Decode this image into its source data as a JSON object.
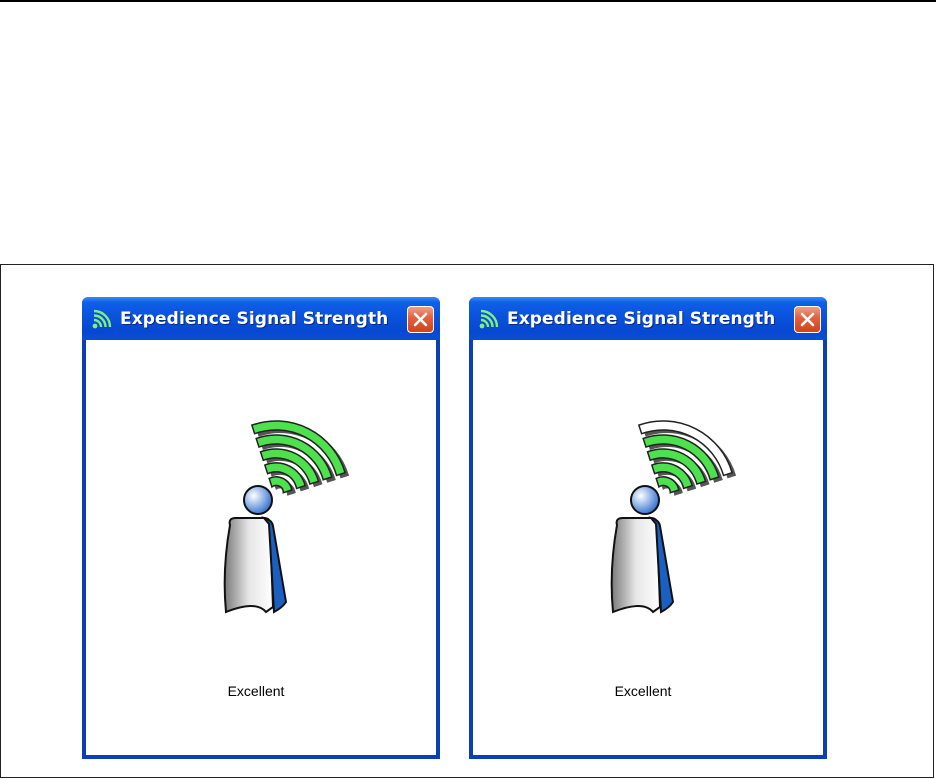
{
  "windows": [
    {
      "title": "Expedience Signal Strength",
      "status": "Excellent",
      "signal_bars_lit": 5,
      "signal_bars_total": 5
    },
    {
      "title": "Expedience Signal Strength",
      "status": "Excellent",
      "signal_bars_lit": 4,
      "signal_bars_total": 5
    }
  ],
  "icons": {
    "title": "signal-strength-icon",
    "close": "close-icon",
    "person": "user-figure-icon"
  },
  "colors": {
    "titlebar": "#0a52dc",
    "window_border": "#0a3fb5",
    "close_button": "#d3421c",
    "signal_lit": "#4de24d",
    "signal_unlit": "#ffffff",
    "head": "#2f6fd0",
    "body_accent": "#1b5fc0"
  }
}
